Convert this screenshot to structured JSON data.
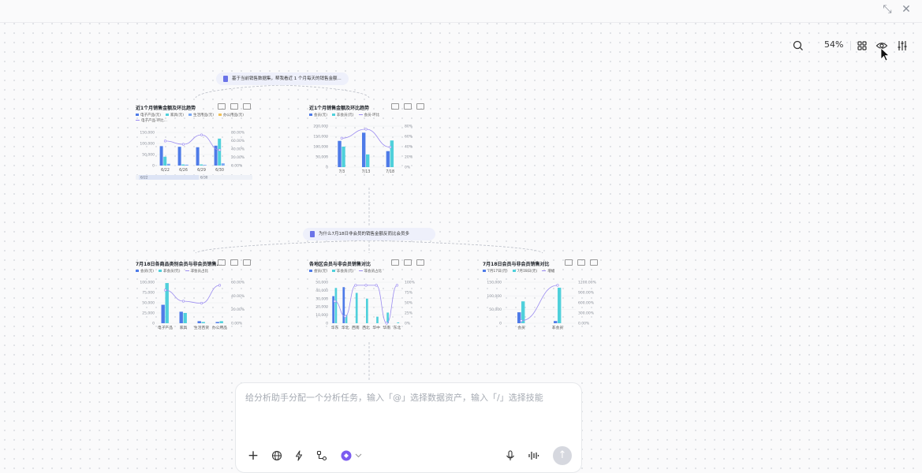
{
  "toolbar": {
    "zoom": "54%"
  },
  "queries": [
    "基于当前销售数据集，帮我看近 1 个月每天的销售金额...",
    "为什么7月18日非会员的销售金额反而比会员多"
  ],
  "input": {
    "placeholder": "给分析助手分配一个分析任务，输入「@」选择数据资产，输入「/」选择技能"
  },
  "colors": {
    "blue": "#4e7be8",
    "cyan": "#4fd0db",
    "purple": "#9b8cf0"
  },
  "chart_data": [
    {
      "type": "bar",
      "title": "近1个月销售金额及环比趋势",
      "legend": [
        "电子产品(元)",
        "家具(元)",
        "生活用品(元)",
        "办公用品(元)",
        "电子产品-环比..."
      ],
      "categories": [
        "6/22",
        "6/26",
        "6/29",
        "6/30"
      ],
      "series": [
        {
          "name": "电子产品(元)",
          "values": [
            88000,
            85000,
            83000,
            90000
          ]
        },
        {
          "name": "家具(元)",
          "values": [
            40000,
            5000,
            5000,
            122000
          ]
        },
        {
          "name": "生活用品(元)",
          "values": [
            8000,
            4000,
            3000,
            10000
          ]
        }
      ],
      "line": {
        "name": "电子产品-环比...",
        "values": [
          60,
          52,
          75,
          38
        ]
      },
      "yticks": [
        "150,000",
        "100,000",
        "50,000",
        "0"
      ],
      "y2ticks": [
        "80.00%",
        "60.00%",
        "40.00%",
        "20.00%",
        "0.00%"
      ],
      "ylim": [
        0,
        150000
      ],
      "slider": {
        "start": "6/22",
        "end": "6/30"
      }
    },
    {
      "type": "bar",
      "title": "近1个月销售金额及环比趋势",
      "legend": [
        "会员(元)",
        "非会员(元)",
        "会员-环比"
      ],
      "categories": [
        "7/3",
        "7/13",
        "7/18"
      ],
      "series": [
        {
          "name": "会员(元)",
          "values": [
            128000,
            168000,
            78000
          ]
        },
        {
          "name": "非会员(元)",
          "values": [
            100000,
            62000,
            130000
          ]
        }
      ],
      "line": {
        "name": "会员-环比",
        "values": [
          58,
          76,
          40
        ]
      },
      "yticks": [
        "200,000",
        "150,000",
        "100,000",
        "50,000",
        "0"
      ],
      "y2ticks": [
        "80%",
        "60%",
        "40%",
        "20%",
        "0%"
      ],
      "ylim": [
        0,
        200000
      ]
    },
    {
      "type": "bar",
      "title": "7月18日各商品类别会员与非会员销售...",
      "legend": [
        "会员(元)",
        "非会员(元)",
        "非会员占比"
      ],
      "categories": [
        "电子产品",
        "家具",
        "生活百货",
        "办公用品"
      ],
      "series": [
        {
          "name": "会员(元)",
          "values": [
            45000,
            28000,
            5000,
            3000
          ]
        },
        {
          "name": "非会员(元)",
          "values": [
            98000,
            25000,
            3000,
            5000
          ]
        }
      ],
      "line": {
        "name": "非会员占比",
        "values": [
          48,
          32,
          29,
          55
        ]
      },
      "yticks": [
        "100,000",
        "75,000",
        "50,000",
        "25,000",
        "0"
      ],
      "y2ticks": [
        "60.00%",
        "40.00%",
        "20.00%",
        "0.00%"
      ],
      "ylim": [
        0,
        100000
      ]
    },
    {
      "type": "bar",
      "title": "各地区会员与非会员销售对比",
      "legend": [
        "会员(元)",
        "非会员(元)",
        "非会员占比"
      ],
      "categories": [
        "华东",
        "华北",
        "西南",
        "西北",
        "华中",
        "华南",
        "东北"
      ],
      "series": [
        {
          "name": "会员(元)",
          "values": [
            33000,
            44000,
            0,
            0,
            0,
            0,
            0
          ]
        },
        {
          "name": "非会员(元)",
          "values": [
            43000,
            10000,
            37000,
            30000,
            8000,
            13000,
            1000
          ]
        }
      ],
      "line": {
        "name": "非会员占比",
        "values": [
          58,
          18,
          100,
          100,
          100,
          0,
          100
        ]
      },
      "yticks": [
        "50,000",
        "40,000",
        "30,000",
        "20,000",
        "10,000",
        "0"
      ],
      "y2ticks": [
        "100%",
        "75%",
        "50%",
        "25%",
        "0%"
      ],
      "ylim": [
        0,
        50000
      ]
    },
    {
      "type": "bar",
      "title": "7月18日会员与非会员销售对比",
      "legend": [
        "7月17日(元)",
        "7月18日(元)",
        "增幅"
      ],
      "categories": [
        "会员",
        "非会员"
      ],
      "series": [
        {
          "name": "7月17日(元)",
          "values": [
            40000,
            8000
          ]
        },
        {
          "name": "7月18日(元)",
          "values": [
            80000,
            130000
          ]
        }
      ],
      "line": {
        "name": "增幅",
        "values": [
          100,
          1500
        ]
      },
      "yticks": [
        "150,000",
        "100,000",
        "50,000",
        "0"
      ],
      "y2ticks": [
        "1200.00%",
        "900.00%",
        "600.00%",
        "300.00%",
        "0.00%"
      ],
      "ylim": [
        0,
        150000
      ]
    }
  ]
}
